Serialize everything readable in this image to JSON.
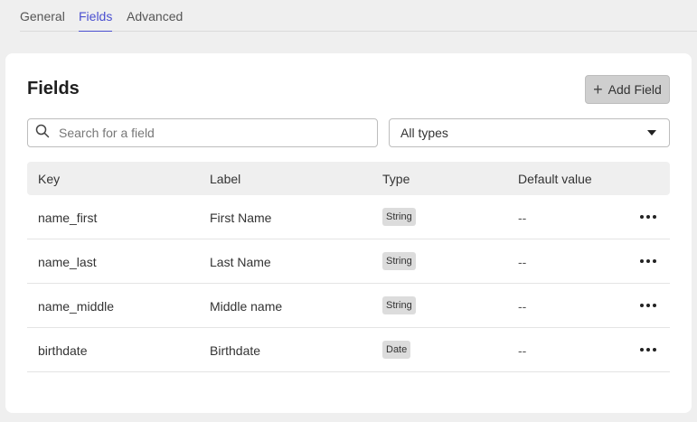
{
  "tabs": [
    {
      "label": "General",
      "active": false
    },
    {
      "label": "Fields",
      "active": true
    },
    {
      "label": "Advanced",
      "active": false
    }
  ],
  "card": {
    "title": "Fields",
    "add_button_label": "Add Field",
    "add_button_icon": "plus-icon"
  },
  "search": {
    "placeholder": "Search for a field",
    "value": "",
    "icon": "search-icon"
  },
  "type_filter": {
    "selected": "All types",
    "icon": "chevron-down-icon"
  },
  "table": {
    "headers": {
      "key": "Key",
      "label": "Label",
      "type": "Type",
      "default": "Default value"
    },
    "rows": [
      {
        "key": "name_first",
        "label": "First Name",
        "type": "String",
        "default": "--"
      },
      {
        "key": "name_last",
        "label": "Last Name",
        "type": "String",
        "default": "--"
      },
      {
        "key": "name_middle",
        "label": "Middle name",
        "type": "String",
        "default": "--"
      },
      {
        "key": "birthdate",
        "label": "Birthdate",
        "type": "Date",
        "default": "--"
      }
    ]
  },
  "colors": {
    "accent": "#4a4fd0",
    "background": "#efefef",
    "card": "#ffffff"
  }
}
